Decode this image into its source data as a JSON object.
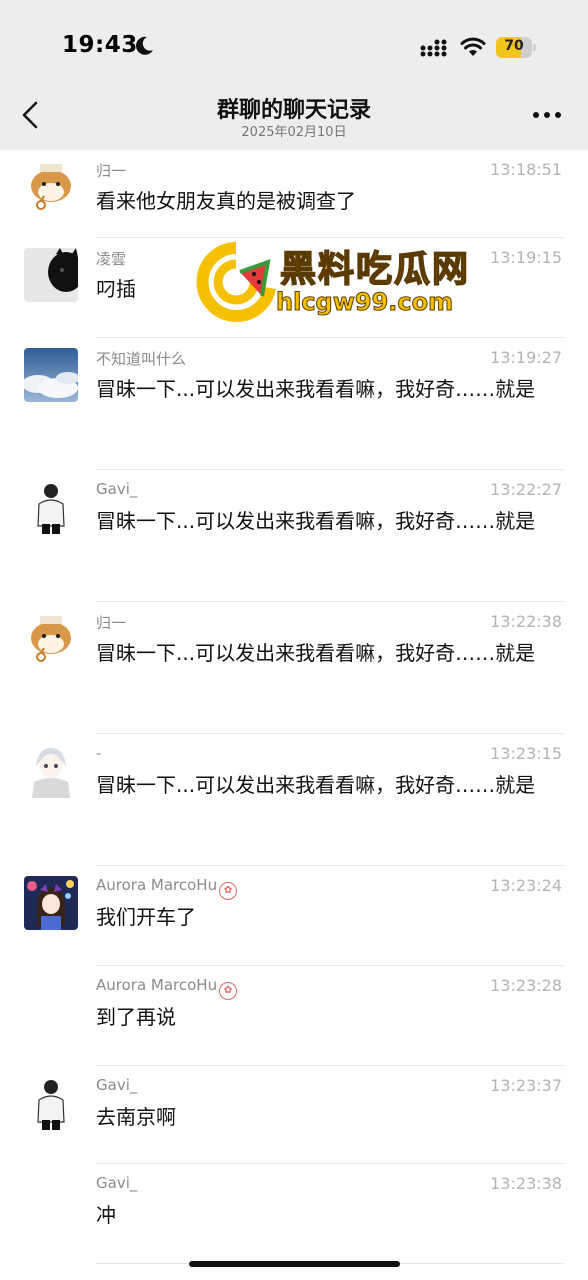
{
  "status_bar": {
    "time": "19:43",
    "icons": [
      "moon-icon",
      "cellular-signal-icon",
      "wifi-icon",
      "battery-icon"
    ],
    "battery_level": 70,
    "battery_label": "70"
  },
  "nav": {
    "title": "群聊的聊天记录",
    "subtitle": "2025年02月10日",
    "back_icon": "chevron-left-icon",
    "more_icon": "ellipsis-icon"
  },
  "watermark": {
    "title": "黑料吃瓜网",
    "url": "hlcgw99.com"
  },
  "messages": [
    {
      "sender": "归一",
      "time": "13:18:51",
      "text": "看来他女朋友真的是被调查了",
      "avatar": "shiba-dog-avatar"
    },
    {
      "sender": "凌雲",
      "time": "13:19:15",
      "text": "叼插",
      "avatar": "black-cat-avatar"
    },
    {
      "sender": "不知道叫什么",
      "time": "13:19:27",
      "text": "冒昧一下...可以发出来我看看嘛，我好奇……就是",
      "avatar": "clouds-avatar"
    },
    {
      "sender": "Gavi_",
      "time": "13:22:27",
      "text": "冒昧一下...可以发出来我看看嘛，我好奇……就是",
      "avatar": "man-bw-avatar"
    },
    {
      "sender": "归一",
      "time": "13:22:38",
      "text": "冒昧一下...可以发出来我看看嘛，我好奇……就是",
      "avatar": "shiba-dog-avatar"
    },
    {
      "sender": "-",
      "time": "13:23:15",
      "text": "冒昧一下...可以发出来我看看嘛，我好奇……就是",
      "avatar": "anime-scarf-avatar"
    },
    {
      "sender": "Aurora MarcoHu",
      "time": "13:23:24",
      "text": "我们开车了",
      "avatar": "anime-girl-avatar",
      "badge": true
    },
    {
      "sender": "Aurora MarcoHu",
      "time": "13:23:28",
      "text": "到了再说",
      "avatar": "",
      "badge": true
    },
    {
      "sender": "Gavi_",
      "time": "13:23:37",
      "text": "去南京啊",
      "avatar": "man-bw-avatar"
    },
    {
      "sender": "Gavi_",
      "time": "13:23:38",
      "text": "冲",
      "avatar": ""
    }
  ]
}
